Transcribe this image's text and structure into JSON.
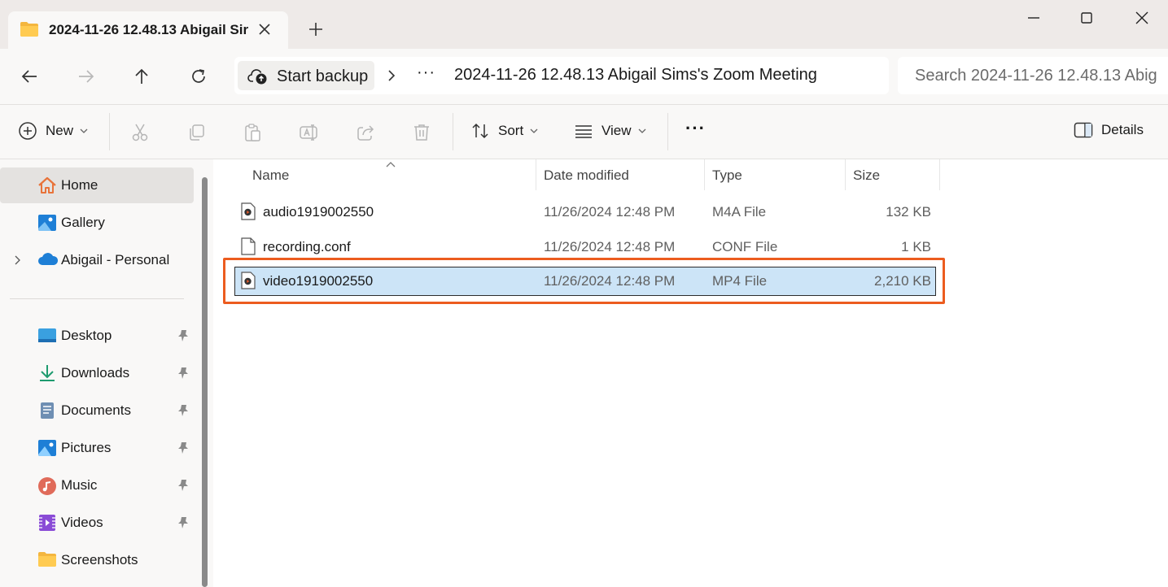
{
  "window": {
    "tab_title": "2024-11-26 12.48.13 Abigail Sir",
    "accent_color": "#ec5c1f",
    "selection_color": "#cce4f7"
  },
  "address": {
    "backup_label": "Start backup",
    "overflow": "···",
    "path": "2024-11-26 12.48.13 Abigail Sims's Zoom Meeting",
    "search_placeholder": "Search 2024-11-26 12.48.13 Abig"
  },
  "commands": {
    "new_label": "New",
    "sort_label": "Sort",
    "view_label": "View",
    "more": "···",
    "details_label": "Details"
  },
  "sidebar": {
    "items": [
      {
        "label": "Home",
        "icon": "home-icon"
      },
      {
        "label": "Gallery",
        "icon": "gallery-icon"
      },
      {
        "label": "Abigail - Personal",
        "icon": "onedrive-cloud-icon"
      },
      {
        "label": "Desktop",
        "icon": "desktop-icon"
      },
      {
        "label": "Downloads",
        "icon": "downloads-icon"
      },
      {
        "label": "Documents",
        "icon": "documents-icon"
      },
      {
        "label": "Pictures",
        "icon": "pictures-icon"
      },
      {
        "label": "Music",
        "icon": "music-icon"
      },
      {
        "label": "Videos",
        "icon": "videos-icon"
      },
      {
        "label": "Screenshots",
        "icon": "folder-icon"
      }
    ]
  },
  "columns": {
    "name": "Name",
    "date": "Date modified",
    "type": "Type",
    "size": "Size"
  },
  "files": [
    {
      "name": "audio1919002550",
      "date": "11/26/2024 12:48 PM",
      "type": "M4A File",
      "size": "132 KB",
      "icon": "media-file-icon"
    },
    {
      "name": "recording.conf",
      "date": "11/26/2024 12:48 PM",
      "type": "CONF File",
      "size": "1 KB",
      "icon": "blank-file-icon"
    },
    {
      "name": "video1919002550",
      "date": "11/26/2024 12:48 PM",
      "type": "MP4 File",
      "size": "2,210 KB",
      "icon": "media-file-icon",
      "selected": true
    }
  ]
}
